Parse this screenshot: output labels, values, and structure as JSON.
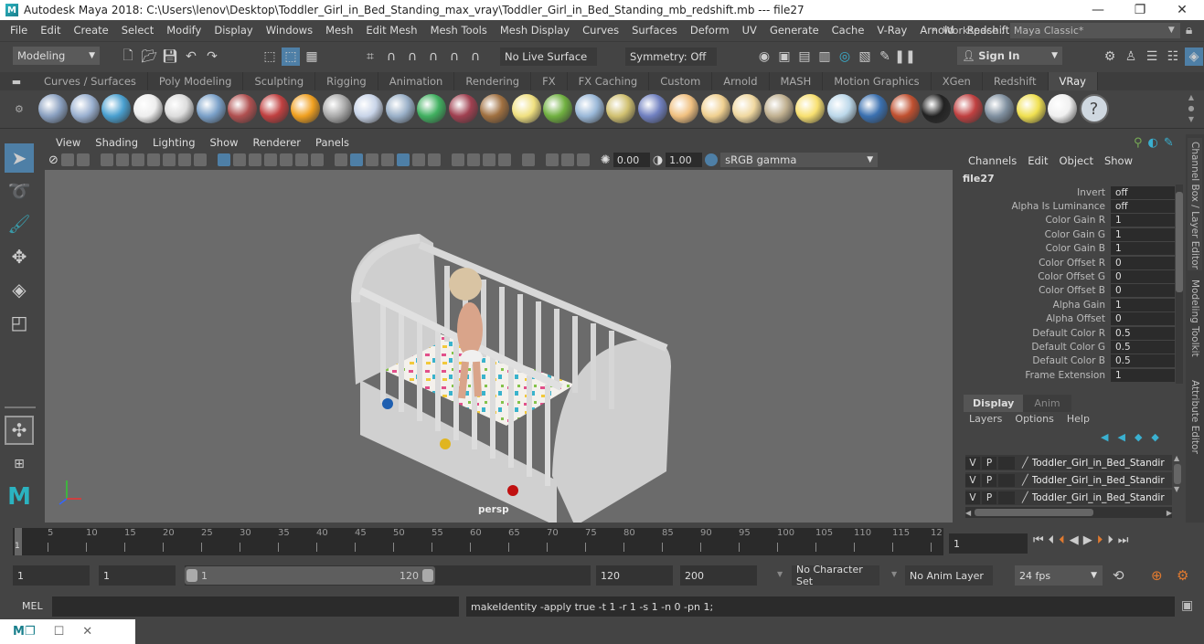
{
  "window": {
    "title": "Autodesk Maya 2018: C:\\Users\\lenov\\Desktop\\Toddler_Girl_in_Bed_Standing_max_vray\\Toddler_Girl_in_Bed_Standing_mb_redshift.mb  ---  file27",
    "logo": "M",
    "controls": {
      "minimize": "—",
      "restore": "❐",
      "close": "✕"
    }
  },
  "menubar": {
    "items": [
      "File",
      "Edit",
      "Create",
      "Select",
      "Modify",
      "Display",
      "Windows",
      "Mesh",
      "Edit Mesh",
      "Mesh Tools",
      "Mesh Display",
      "Curves",
      "Surfaces",
      "Deform",
      "UV",
      "Generate",
      "Cache",
      "V-Ray",
      "Arnold",
      "Redshift"
    ],
    "workspace_label": "Workspace :",
    "workspace_value": "Maya Classic*"
  },
  "statusline": {
    "menuset": "Modeling",
    "live_surface": "No Live Surface",
    "symmetry": "Symmetry: Off",
    "sign_in": "Sign In"
  },
  "shelf": {
    "tabs": [
      "Curves / Surfaces",
      "Poly Modeling",
      "Sculpting",
      "Rigging",
      "Animation",
      "Rendering",
      "FX",
      "FX Caching",
      "Custom",
      "Arnold",
      "MASH",
      "Motion Graphics",
      "XGen",
      "Redshift",
      "VRay"
    ],
    "active_tab": "VRay",
    "icons": [
      "vray-save-icon",
      "vray-batch-icon",
      "vray-scene-list-icon",
      "vray-logo-icon",
      "vray-log-icon",
      "vray-material-icon",
      "vray-camera-icon",
      "vray-blend-icon",
      "vray-fire-icon",
      "vray-proxy-icon",
      "vray-plane-icon",
      "vray-cone-icon",
      "vray-fur-icon",
      "vray-displacement-icon",
      "vray-texture-icon",
      "vray-sphere-light-icon",
      "vray-grass-icon",
      "vray-particle-icon",
      "vray-curves-icon",
      "vray-globe-icon",
      "vray-dome-icon",
      "vray-spot-icon",
      "vray-ies-icon",
      "vray-beam-icon",
      "vray-sun-icon",
      "vray-rect-light-icon",
      "vray-ball-icon",
      "vray-mtl-icon",
      "vray-checker-icon",
      "vray-vfb-icon",
      "vray-settings-icon",
      "vray-light-lister-icon",
      "vray-cloud-icon",
      "help-icon"
    ]
  },
  "viewport": {
    "menu": [
      "View",
      "Shading",
      "Lighting",
      "Show",
      "Renderer",
      "Panels"
    ],
    "exposure": "0.00",
    "gamma": "1.00",
    "color_space": "sRGB gamma",
    "camera_label": "persp"
  },
  "channel_box": {
    "menu": [
      "Channels",
      "Edit",
      "Object",
      "Show"
    ],
    "node": "file27",
    "attributes": [
      {
        "label": "Invert",
        "value": "off"
      },
      {
        "label": "Alpha Is Luminance",
        "value": "off"
      },
      {
        "label": "Color Gain R",
        "value": "1"
      },
      {
        "label": "Color Gain G",
        "value": "1"
      },
      {
        "label": "Color Gain B",
        "value": "1"
      },
      {
        "label": "Color Offset R",
        "value": "0"
      },
      {
        "label": "Color Offset G",
        "value": "0"
      },
      {
        "label": "Color Offset B",
        "value": "0"
      },
      {
        "label": "Alpha Gain",
        "value": "1"
      },
      {
        "label": "Alpha Offset",
        "value": "0"
      },
      {
        "label": "Default Color R",
        "value": "0.5"
      },
      {
        "label": "Default Color G",
        "value": "0.5"
      },
      {
        "label": "Default Color B",
        "value": "0.5"
      },
      {
        "label": "Frame Extension",
        "value": "1"
      }
    ]
  },
  "side_tabs": [
    "Channel Box / Layer Editor",
    "Modeling Toolkit",
    "Attribute Editor"
  ],
  "layer_editor": {
    "tabs": [
      "Display",
      "Anim"
    ],
    "active_tab": "Display",
    "menu": [
      "Layers",
      "Options",
      "Help"
    ],
    "layers": [
      {
        "v": "V",
        "p": "P",
        "name": "Toddler_Girl_in_Bed_Standir"
      },
      {
        "v": "V",
        "p": "P",
        "name": "Toddler_Girl_in_Bed_Standir"
      },
      {
        "v": "V",
        "p": "P",
        "name": "Toddler_Girl_in_Bed_Standir"
      }
    ]
  },
  "timeline": {
    "ticks": [
      "5",
      "10",
      "15",
      "20",
      "25",
      "30",
      "35",
      "40",
      "45",
      "50",
      "55",
      "60",
      "65",
      "70",
      "75",
      "80",
      "85",
      "90",
      "95",
      "100",
      "105",
      "110",
      "115",
      "12"
    ],
    "current_frame_marker": "1",
    "current_frame": "1"
  },
  "range": {
    "start": "1",
    "playback_start": "1",
    "slider_start": "1",
    "slider_end": "120",
    "playback_end": "120",
    "end": "200",
    "character_set": "No Character Set",
    "anim_layer": "No Anim Layer",
    "fps": "24 fps"
  },
  "command_line": {
    "lang": "MEL",
    "input": "",
    "result": "makeIdentity -apply true -t 1 -r 1 -s 1 -n 0 -pn 1;"
  }
}
